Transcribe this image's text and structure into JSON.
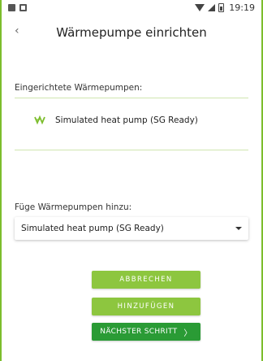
{
  "status_bar": {
    "time": "19:19"
  },
  "header": {
    "back_symbol": "‹",
    "title": "Wärmepumpe einrichten"
  },
  "installed": {
    "label": "Eingerichtete Wärmepumpen:",
    "items": [
      {
        "name": "Simulated heat pump (SG Ready)",
        "icon": "heat-pump-icon"
      }
    ]
  },
  "add": {
    "label": "Füge Wärmepumpen hinzu:",
    "selected": "Simulated heat pump (SG Ready)"
  },
  "buttons": {
    "cancel": "ABBRECHEN",
    "add": "HINZUFÜGEN",
    "next": "NÄCHSTER SCHRITT",
    "next_chevron": "〉"
  },
  "colors": {
    "accent": "#8dc63f",
    "primary": "#2a9b35",
    "frame": "#7cbd2c"
  }
}
